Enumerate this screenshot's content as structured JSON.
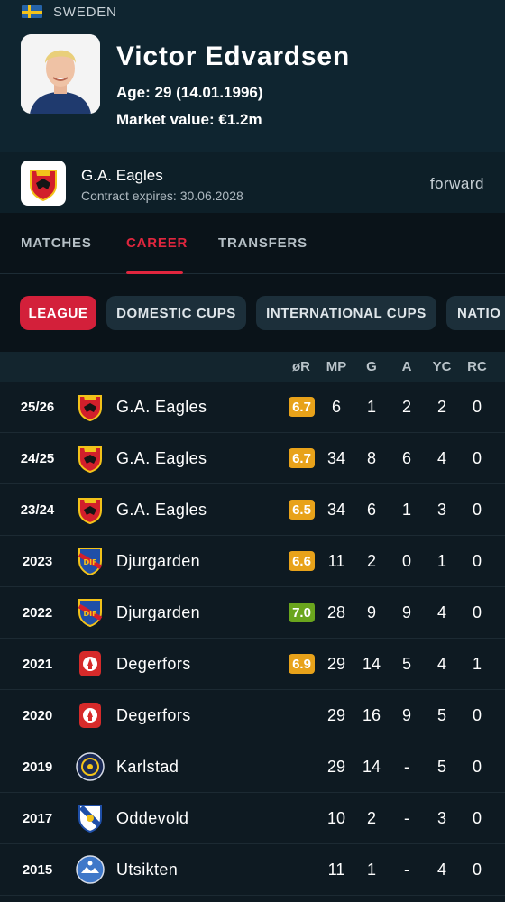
{
  "country": "SWEDEN",
  "player": {
    "name": "Victor Edvardsen",
    "age_line": "Age: 29 (14.01.1996)",
    "market_line": "Market value: €1.2m",
    "position": "forward"
  },
  "club": {
    "name": "G.A. Eagles",
    "contract_line": "Contract expires: 30.06.2028"
  },
  "tabs": [
    {
      "label": "MATCHES",
      "active": false
    },
    {
      "label": "CAREER",
      "active": true
    },
    {
      "label": "TRANSFERS",
      "active": false
    }
  ],
  "filters": [
    {
      "label": "LEAGUE",
      "active": true
    },
    {
      "label": "DOMESTIC CUPS",
      "active": false
    },
    {
      "label": "INTERNATIONAL CUPS",
      "active": false
    },
    {
      "label": "NATIO",
      "active": false
    }
  ],
  "table": {
    "headers": [
      "øR",
      "MP",
      "G",
      "A",
      "YC",
      "RC"
    ],
    "rows": [
      {
        "season": "25/26",
        "club": "G.A. Eagles",
        "logo": "ga-eagles-logo",
        "rating": "6.7",
        "rating_color": "#e8a21a",
        "mp": "6",
        "g": "1",
        "a": "2",
        "yc": "2",
        "rc": "0"
      },
      {
        "season": "24/25",
        "club": "G.A. Eagles",
        "logo": "ga-eagles-logo",
        "rating": "6.7",
        "rating_color": "#e8a21a",
        "mp": "34",
        "g": "8",
        "a": "6",
        "yc": "4",
        "rc": "0"
      },
      {
        "season": "23/24",
        "club": "G.A. Eagles",
        "logo": "ga-eagles-logo",
        "rating": "6.5",
        "rating_color": "#e8a21a",
        "mp": "34",
        "g": "6",
        "a": "1",
        "yc": "3",
        "rc": "0"
      },
      {
        "season": "2023",
        "club": "Djurgarden",
        "logo": "djurgarden-logo",
        "rating": "6.6",
        "rating_color": "#e8a21a",
        "mp": "11",
        "g": "2",
        "a": "0",
        "yc": "1",
        "rc": "0"
      },
      {
        "season": "2022",
        "club": "Djurgarden",
        "logo": "djurgarden-logo",
        "rating": "7.0",
        "rating_color": "#6aa51d",
        "mp": "28",
        "g": "9",
        "a": "9",
        "yc": "4",
        "rc": "0"
      },
      {
        "season": "2021",
        "club": "Degerfors",
        "logo": "degerfors-logo",
        "rating": "6.9",
        "rating_color": "#e8a21a",
        "mp": "29",
        "g": "14",
        "a": "5",
        "yc": "4",
        "rc": "1"
      },
      {
        "season": "2020",
        "club": "Degerfors",
        "logo": "degerfors-logo",
        "rating": "",
        "rating_color": "",
        "mp": "29",
        "g": "16",
        "a": "9",
        "yc": "5",
        "rc": "0"
      },
      {
        "season": "2019",
        "club": "Karlstad",
        "logo": "karlstad-logo",
        "rating": "",
        "rating_color": "",
        "mp": "29",
        "g": "14",
        "a": "-",
        "yc": "5",
        "rc": "0"
      },
      {
        "season": "2017",
        "club": "Oddevold",
        "logo": "oddevold-logo",
        "rating": "",
        "rating_color": "",
        "mp": "10",
        "g": "2",
        "a": "-",
        "yc": "3",
        "rc": "0"
      },
      {
        "season": "2015",
        "club": "Utsikten",
        "logo": "utsikten-logo",
        "rating": "",
        "rating_color": "",
        "mp": "11",
        "g": "1",
        "a": "-",
        "yc": "4",
        "rc": "0"
      }
    ]
  }
}
